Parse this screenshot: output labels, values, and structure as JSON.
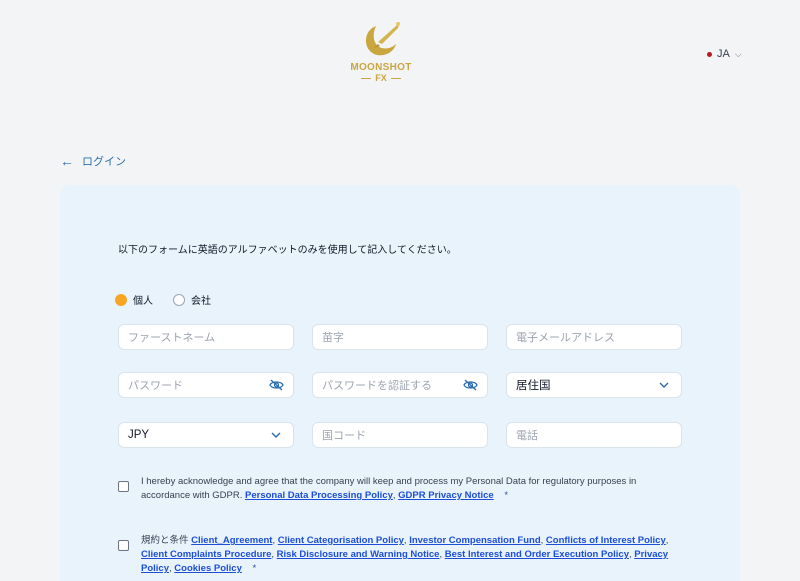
{
  "brand": {
    "name": "MOONSHOT",
    "sub": "FX"
  },
  "header": {
    "language": "JA"
  },
  "nav": {
    "back_label": "ログイン"
  },
  "form": {
    "intro": "以下のフォームに英語のアルファベットのみを使用して記入してください。",
    "account_type": {
      "options": [
        {
          "label": "個人",
          "selected": true
        },
        {
          "label": "会社",
          "selected": false
        }
      ]
    },
    "fields": {
      "first_name": {
        "placeholder": "ファーストネーム"
      },
      "last_name": {
        "placeholder": "苗字"
      },
      "email": {
        "placeholder": "電子メールアドレス"
      },
      "password": {
        "placeholder": "パスワード"
      },
      "confirm_password": {
        "placeholder": "パスワードを認証する"
      },
      "country": {
        "value": "居住国"
      },
      "currency": {
        "value": "JPY"
      },
      "country_code": {
        "placeholder": "国コード"
      },
      "phone": {
        "placeholder": "電話"
      }
    },
    "gdpr": {
      "text": "I hereby acknowledge and agree that the company will keep and process my Personal Data for regulatory purposes in accordance with GDPR.",
      "links": [
        "Personal Data Processing Policy",
        "GDPR Privacy Notice"
      ],
      "required_mark": "*"
    },
    "terms": {
      "prefix": "規約と条件",
      "links": [
        "Client_Agreement",
        "Client Categorisation Policy",
        "Investor Compensation Fund",
        "Conflicts of Interest Policy",
        "Client Complaints Procedure",
        "Risk Disclosure and Warning Notice",
        "Best Interest and Order Execution Policy",
        "Privacy Policy",
        "Cookies Policy"
      ],
      "required_mark": "*"
    }
  },
  "colors": {
    "accent": "#f6a623",
    "link": "#2b6cb0",
    "card": "#e8f3fc",
    "gold": "#c9a640"
  }
}
